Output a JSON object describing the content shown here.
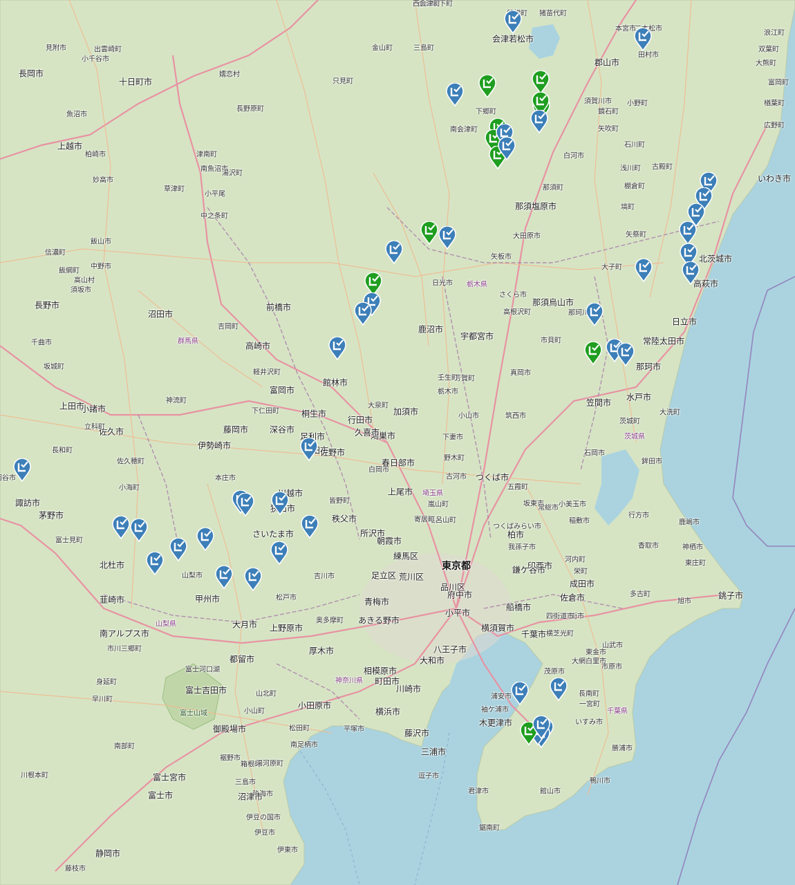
{
  "colors": {
    "sea": "#aad3df",
    "land": "#d6e4c4",
    "highway": "#e892a2",
    "primary_road": "#f7c59f",
    "border": "#a879a8",
    "marker_green": "#1f9e1f",
    "marker_blue": "#3d7fb8"
  },
  "places": [
    {
      "name": "会津坂下町",
      "type": "town"
    },
    {
      "name": "磐梯町",
      "type": "town"
    },
    {
      "name": "猪苗代町",
      "type": "town"
    },
    {
      "name": "会津若松市",
      "type": "city"
    },
    {
      "name": "二本松市",
      "type": "town"
    },
    {
      "name": "本宮市",
      "type": "town"
    },
    {
      "name": "郡山市",
      "type": "city"
    },
    {
      "name": "田村市",
      "type": "town"
    },
    {
      "name": "浪江町",
      "type": "town"
    },
    {
      "name": "双葉町",
      "type": "town"
    },
    {
      "name": "大熊町",
      "type": "town"
    },
    {
      "name": "富岡町",
      "type": "town"
    },
    {
      "name": "楢葉町",
      "type": "town"
    },
    {
      "name": "広野町",
      "type": "town"
    },
    {
      "name": "いわき市",
      "type": "city"
    },
    {
      "name": "小野町",
      "type": "town"
    },
    {
      "name": "須賀川市",
      "type": "town"
    },
    {
      "name": "鏡石町",
      "type": "town"
    },
    {
      "name": "矢吹町",
      "type": "town"
    },
    {
      "name": "石川町",
      "type": "town"
    },
    {
      "name": "白河市",
      "type": "town"
    },
    {
      "name": "古殿町",
      "type": "town"
    },
    {
      "name": "浅川町",
      "type": "town"
    },
    {
      "name": "棚倉町",
      "type": "town"
    },
    {
      "name": "塙町",
      "type": "town"
    },
    {
      "name": "矢祭町",
      "type": "town"
    },
    {
      "name": "那須町",
      "type": "town"
    },
    {
      "name": "那須塩原市",
      "type": "city"
    },
    {
      "name": "大田原市",
      "type": "town"
    },
    {
      "name": "下郷町",
      "type": "town"
    },
    {
      "name": "南会津町",
      "type": "town"
    },
    {
      "name": "只見町",
      "type": "town"
    },
    {
      "name": "金山町",
      "type": "town"
    },
    {
      "name": "三島町",
      "type": "town"
    },
    {
      "name": "西会津町",
      "type": "town"
    },
    {
      "name": "矢板市",
      "type": "town"
    },
    {
      "name": "日光市",
      "type": "town"
    },
    {
      "name": "栃木県",
      "type": "pref"
    },
    {
      "name": "さくら市",
      "type": "town"
    },
    {
      "name": "那須烏山市",
      "type": "city"
    },
    {
      "name": "那珂川町",
      "type": "town"
    },
    {
      "name": "高根沢町",
      "type": "town"
    },
    {
      "name": "大子町",
      "type": "town"
    },
    {
      "name": "北茨城市",
      "type": "city"
    },
    {
      "name": "高萩市",
      "type": "city"
    },
    {
      "name": "日立市",
      "type": "city"
    },
    {
      "name": "常陸太田市",
      "type": "city"
    },
    {
      "name": "那珂市",
      "type": "city"
    },
    {
      "name": "鹿沼市",
      "type": "city"
    },
    {
      "name": "宇都宮市",
      "type": "city"
    },
    {
      "name": "芳賀町",
      "type": "town"
    },
    {
      "name": "市貝町",
      "type": "town"
    },
    {
      "name": "壬生町",
      "type": "town"
    },
    {
      "name": "真岡市",
      "type": "town"
    },
    {
      "name": "笠間市",
      "type": "city"
    },
    {
      "name": "水戸市",
      "type": "city"
    },
    {
      "name": "大洗町",
      "type": "town"
    },
    {
      "name": "茨城町",
      "type": "town"
    },
    {
      "name": "茨城県",
      "type": "pref"
    },
    {
      "name": "石岡市",
      "type": "town"
    },
    {
      "name": "鉾田市",
      "type": "town"
    },
    {
      "name": "栃木市",
      "type": "town"
    },
    {
      "name": "小山市",
      "type": "town"
    },
    {
      "name": "筑西市",
      "type": "town"
    },
    {
      "name": "下妻市",
      "type": "town"
    },
    {
      "name": "野木町",
      "type": "town"
    },
    {
      "name": "古河市",
      "type": "town"
    },
    {
      "name": "五霞町",
      "type": "town"
    },
    {
      "name": "つくば市",
      "type": "city"
    },
    {
      "name": "坂東市",
      "type": "town"
    },
    {
      "name": "常総市",
      "type": "town"
    },
    {
      "name": "つくばみらい市",
      "type": "town"
    },
    {
      "name": "小美玉市",
      "type": "town"
    },
    {
      "name": "稲敷市",
      "type": "town"
    },
    {
      "name": "行方市",
      "type": "town"
    },
    {
      "name": "鹿嶋市",
      "type": "town"
    },
    {
      "name": "神栖市",
      "type": "town"
    },
    {
      "name": "香取市",
      "type": "town"
    },
    {
      "name": "東庄町",
      "type": "town"
    },
    {
      "name": "銚子市",
      "type": "city"
    },
    {
      "name": "旭市",
      "type": "town"
    },
    {
      "name": "多古町",
      "type": "town"
    },
    {
      "name": "成田市",
      "type": "city"
    },
    {
      "name": "印西市",
      "type": "city"
    },
    {
      "name": "河内町",
      "type": "town"
    },
    {
      "name": "栄町",
      "type": "town"
    },
    {
      "name": "柏市",
      "type": "city"
    },
    {
      "name": "我孫子市",
      "type": "town"
    },
    {
      "name": "鎌ケ谷市",
      "type": "city"
    },
    {
      "name": "船橋市",
      "type": "city"
    },
    {
      "name": "佐倉市",
      "type": "city"
    },
    {
      "name": "八街市",
      "type": "town"
    },
    {
      "name": "四街道市",
      "type": "town"
    },
    {
      "name": "横芝光町",
      "type": "town"
    },
    {
      "name": "千葉市",
      "type": "city"
    },
    {
      "name": "山武市",
      "type": "town"
    },
    {
      "name": "東金市",
      "type": "town"
    },
    {
      "name": "大網白里市",
      "type": "town"
    },
    {
      "name": "市原市",
      "type": "town"
    },
    {
      "name": "茂原市",
      "type": "town"
    },
    {
      "name": "長南町",
      "type": "town"
    },
    {
      "name": "一宮町",
      "type": "town"
    },
    {
      "name": "千葉県",
      "type": "pref"
    },
    {
      "name": "いすみ市",
      "type": "town"
    },
    {
      "name": "勝浦市",
      "type": "town"
    },
    {
      "name": "鴨川市",
      "type": "town"
    },
    {
      "name": "館山市",
      "type": "town"
    },
    {
      "name": "鋸南町",
      "type": "town"
    },
    {
      "name": "君津市",
      "type": "town"
    },
    {
      "name": "木更津市",
      "type": "city"
    },
    {
      "name": "袖ケ浦市",
      "type": "town"
    },
    {
      "name": "浦安市",
      "type": "town"
    },
    {
      "name": "横須賀市",
      "type": "city"
    },
    {
      "name": "三浦市",
      "type": "city"
    },
    {
      "name": "逗子市",
      "type": "town"
    },
    {
      "name": "藤沢市",
      "type": "city"
    },
    {
      "name": "横浜市",
      "type": "city"
    },
    {
      "name": "川崎市",
      "type": "city"
    },
    {
      "name": "大和市",
      "type": "city"
    },
    {
      "name": "町田市",
      "type": "city"
    },
    {
      "name": "相模原市",
      "type": "city"
    },
    {
      "name": "厚木市",
      "type": "city"
    },
    {
      "name": "神奈川県",
      "type": "pref"
    },
    {
      "name": "平塚市",
      "type": "town"
    },
    {
      "name": "小田原市",
      "type": "city"
    },
    {
      "name": "南足柄市",
      "type": "town"
    },
    {
      "name": "松田町",
      "type": "town"
    },
    {
      "name": "山北町",
      "type": "town"
    },
    {
      "name": "小山町",
      "type": "town"
    },
    {
      "name": "箱根町",
      "type": "town"
    },
    {
      "name": "湯河原町",
      "type": "town"
    },
    {
      "name": "熱海市",
      "type": "town"
    },
    {
      "name": "三島市",
      "type": "town"
    },
    {
      "name": "沼津市",
      "type": "city"
    },
    {
      "name": "伊豆の国市",
      "type": "town"
    },
    {
      "name": "伊豆市",
      "type": "town"
    },
    {
      "name": "伊東市",
      "type": "town"
    },
    {
      "name": "裾野市",
      "type": "town"
    },
    {
      "name": "御殿場市",
      "type": "city"
    },
    {
      "name": "富士宮市",
      "type": "city"
    },
    {
      "name": "富士市",
      "type": "city"
    },
    {
      "name": "静岡市",
      "type": "city"
    },
    {
      "name": "藤枝市",
      "type": "town"
    },
    {
      "name": "川根本町",
      "type": "town"
    },
    {
      "name": "南部町",
      "type": "town"
    },
    {
      "name": "早川町",
      "type": "town"
    },
    {
      "name": "身延町",
      "type": "town"
    },
    {
      "name": "市川三郷町",
      "type": "town"
    },
    {
      "name": "南アルプス市",
      "type": "city"
    },
    {
      "name": "山梨県",
      "type": "pref"
    },
    {
      "name": "富士河口湖",
      "type": "town"
    },
    {
      "name": "富士吉田市",
      "type": "city"
    },
    {
      "name": "富士山域",
      "type": "park"
    },
    {
      "name": "都留市",
      "type": "city"
    },
    {
      "name": "大月市",
      "type": "city"
    },
    {
      "name": "上野原市",
      "type": "city"
    },
    {
      "name": "甲州市",
      "type": "city"
    },
    {
      "name": "山梨市",
      "type": "town"
    },
    {
      "name": "北杜市",
      "type": "city"
    },
    {
      "name": "韮崎市",
      "type": "city"
    },
    {
      "name": "富士見町",
      "type": "town"
    },
    {
      "name": "茅野市",
      "type": "city"
    },
    {
      "name": "諏訪市",
      "type": "city"
    },
    {
      "name": "岡谷市",
      "type": "town"
    },
    {
      "name": "長和町",
      "type": "town"
    },
    {
      "name": "佐久穂町",
      "type": "town"
    },
    {
      "name": "小海町",
      "type": "town"
    },
    {
      "name": "佐久市",
      "type": "city"
    },
    {
      "name": "小諸市",
      "type": "city"
    },
    {
      "name": "立科町",
      "type": "town"
    },
    {
      "name": "上田市",
      "type": "city"
    },
    {
      "name": "坂城町",
      "type": "town"
    },
    {
      "name": "千曲市",
      "type": "town"
    },
    {
      "name": "長野市",
      "type": "city"
    },
    {
      "name": "須坂市",
      "type": "town"
    },
    {
      "name": "高山村",
      "type": "town"
    },
    {
      "name": "飯綱町",
      "type": "town"
    },
    {
      "name": "信濃町",
      "type": "town"
    },
    {
      "name": "飯山市",
      "type": "town"
    },
    {
      "name": "中野市",
      "type": "town"
    },
    {
      "name": "妙高市",
      "type": "town"
    },
    {
      "name": "上越市",
      "type": "city"
    },
    {
      "name": "柏崎市",
      "type": "town"
    },
    {
      "name": "長岡市",
      "type": "city"
    },
    {
      "name": "出雲崎町",
      "type": "town"
    },
    {
      "name": "見附市",
      "type": "town"
    },
    {
      "name": "小千谷市",
      "type": "town"
    },
    {
      "name": "魚沼市",
      "type": "town"
    },
    {
      "name": "十日町市",
      "type": "city"
    },
    {
      "name": "津南町",
      "type": "town"
    },
    {
      "name": "南魚沼市",
      "type": "town"
    },
    {
      "name": "湯沢町",
      "type": "town"
    },
    {
      "name": "小平尾",
      "type": "town"
    },
    {
      "name": "嬬恋村",
      "type": "town"
    },
    {
      "name": "長野原町",
      "type": "town"
    },
    {
      "name": "草津町",
      "type": "town"
    },
    {
      "name": "中之条町",
      "type": "town"
    },
    {
      "name": "沼田市",
      "type": "city"
    },
    {
      "name": "群馬県",
      "type": "pref"
    },
    {
      "name": "吉岡町",
      "type": "town"
    },
    {
      "name": "前橋市",
      "type": "city"
    },
    {
      "name": "高崎市",
      "type": "city"
    },
    {
      "name": "軽井沢町",
      "type": "town"
    },
    {
      "name": "富岡市",
      "type": "city"
    },
    {
      "name": "下仁田町",
      "type": "town"
    },
    {
      "name": "神流町",
      "type": "town"
    },
    {
      "name": "藤岡市",
      "type": "city"
    },
    {
      "name": "伊勢崎市",
      "type": "city"
    },
    {
      "name": "本庄市",
      "type": "town"
    },
    {
      "name": "深谷市",
      "type": "city"
    },
    {
      "name": "桐生市",
      "type": "city"
    },
    {
      "name": "足利市",
      "type": "city"
    },
    {
      "name": "太田市",
      "type": "city"
    },
    {
      "name": "佐野市",
      "type": "city"
    },
    {
      "name": "館林市",
      "type": "city"
    },
    {
      "name": "大泉町",
      "type": "town"
    },
    {
      "name": "行田市",
      "type": "city"
    },
    {
      "name": "加須市",
      "type": "city"
    },
    {
      "name": "鴻巣市",
      "type": "city"
    },
    {
      "name": "久喜市",
      "type": "city"
    },
    {
      "name": "白岡市",
      "type": "town"
    },
    {
      "name": "春日部市",
      "type": "city"
    },
    {
      "name": "上尾市",
      "type": "city"
    },
    {
      "name": "埼玉県",
      "type": "pref"
    },
    {
      "name": "嵐山町",
      "type": "town"
    },
    {
      "name": "毛呂山町",
      "type": "town"
    },
    {
      "name": "寄居町",
      "type": "town"
    },
    {
      "name": "皆野町",
      "type": "town"
    },
    {
      "name": "秩父市",
      "type": "city"
    },
    {
      "name": "川越市",
      "type": "city"
    },
    {
      "name": "狭山市",
      "type": "city"
    },
    {
      "name": "さいたま市",
      "type": "city"
    },
    {
      "name": "所沢市",
      "type": "city"
    },
    {
      "name": "朝霞市",
      "type": "city"
    },
    {
      "name": "練馬区",
      "type": "city"
    },
    {
      "name": "足立区",
      "type": "city"
    },
    {
      "name": "荒川区",
      "type": "city"
    },
    {
      "name": "東京都",
      "type": "metro"
    },
    {
      "name": "品川区",
      "type": "city"
    },
    {
      "name": "府中市",
      "type": "city"
    },
    {
      "name": "小平市",
      "type": "city"
    },
    {
      "name": "八王子市",
      "type": "city"
    },
    {
      "name": "あきる野市",
      "type": "city"
    },
    {
      "name": "青梅市",
      "type": "city"
    },
    {
      "name": "奥多摩町",
      "type": "town"
    },
    {
      "name": "松戸市",
      "type": "town"
    },
    {
      "name": "吉川市",
      "type": "town"
    }
  ],
  "markers": [
    {
      "type": "green"
    },
    {
      "type": "blue"
    },
    {
      "type": "blue"
    },
    {
      "type": "green"
    },
    {
      "type": "green"
    },
    {
      "type": "green"
    },
    {
      "type": "blue"
    },
    {
      "type": "green"
    },
    {
      "type": "blue"
    },
    {
      "type": "green"
    },
    {
      "type": "blue"
    },
    {
      "type": "green"
    },
    {
      "type": "blue"
    },
    {
      "type": "blue"
    },
    {
      "type": "blue"
    },
    {
      "type": "blue"
    },
    {
      "type": "blue"
    },
    {
      "type": "blue"
    },
    {
      "type": "blue"
    },
    {
      "type": "green"
    },
    {
      "type": "blue"
    },
    {
      "type": "blue"
    },
    {
      "type": "green"
    },
    {
      "type": "blue"
    },
    {
      "type": "blue"
    },
    {
      "type": "blue"
    },
    {
      "type": "blue"
    },
    {
      "type": "blue"
    },
    {
      "type": "green"
    },
    {
      "type": "blue"
    },
    {
      "type": "blue"
    },
    {
      "type": "blue"
    },
    {
      "type": "blue"
    },
    {
      "type": "blue"
    },
    {
      "type": "blue"
    },
    {
      "type": "blue"
    },
    {
      "type": "blue"
    },
    {
      "type": "blue"
    },
    {
      "type": "blue"
    },
    {
      "type": "blue"
    },
    {
      "type": "blue"
    },
    {
      "type": "blue"
    },
    {
      "type": "blue"
    },
    {
      "type": "blue"
    },
    {
      "type": "blue"
    },
    {
      "type": "blue"
    },
    {
      "type": "blue"
    },
    {
      "type": "blue"
    },
    {
      "type": "blue"
    },
    {
      "type": "green"
    },
    {
      "type": "blue"
    },
    {
      "type": "blue"
    }
  ]
}
